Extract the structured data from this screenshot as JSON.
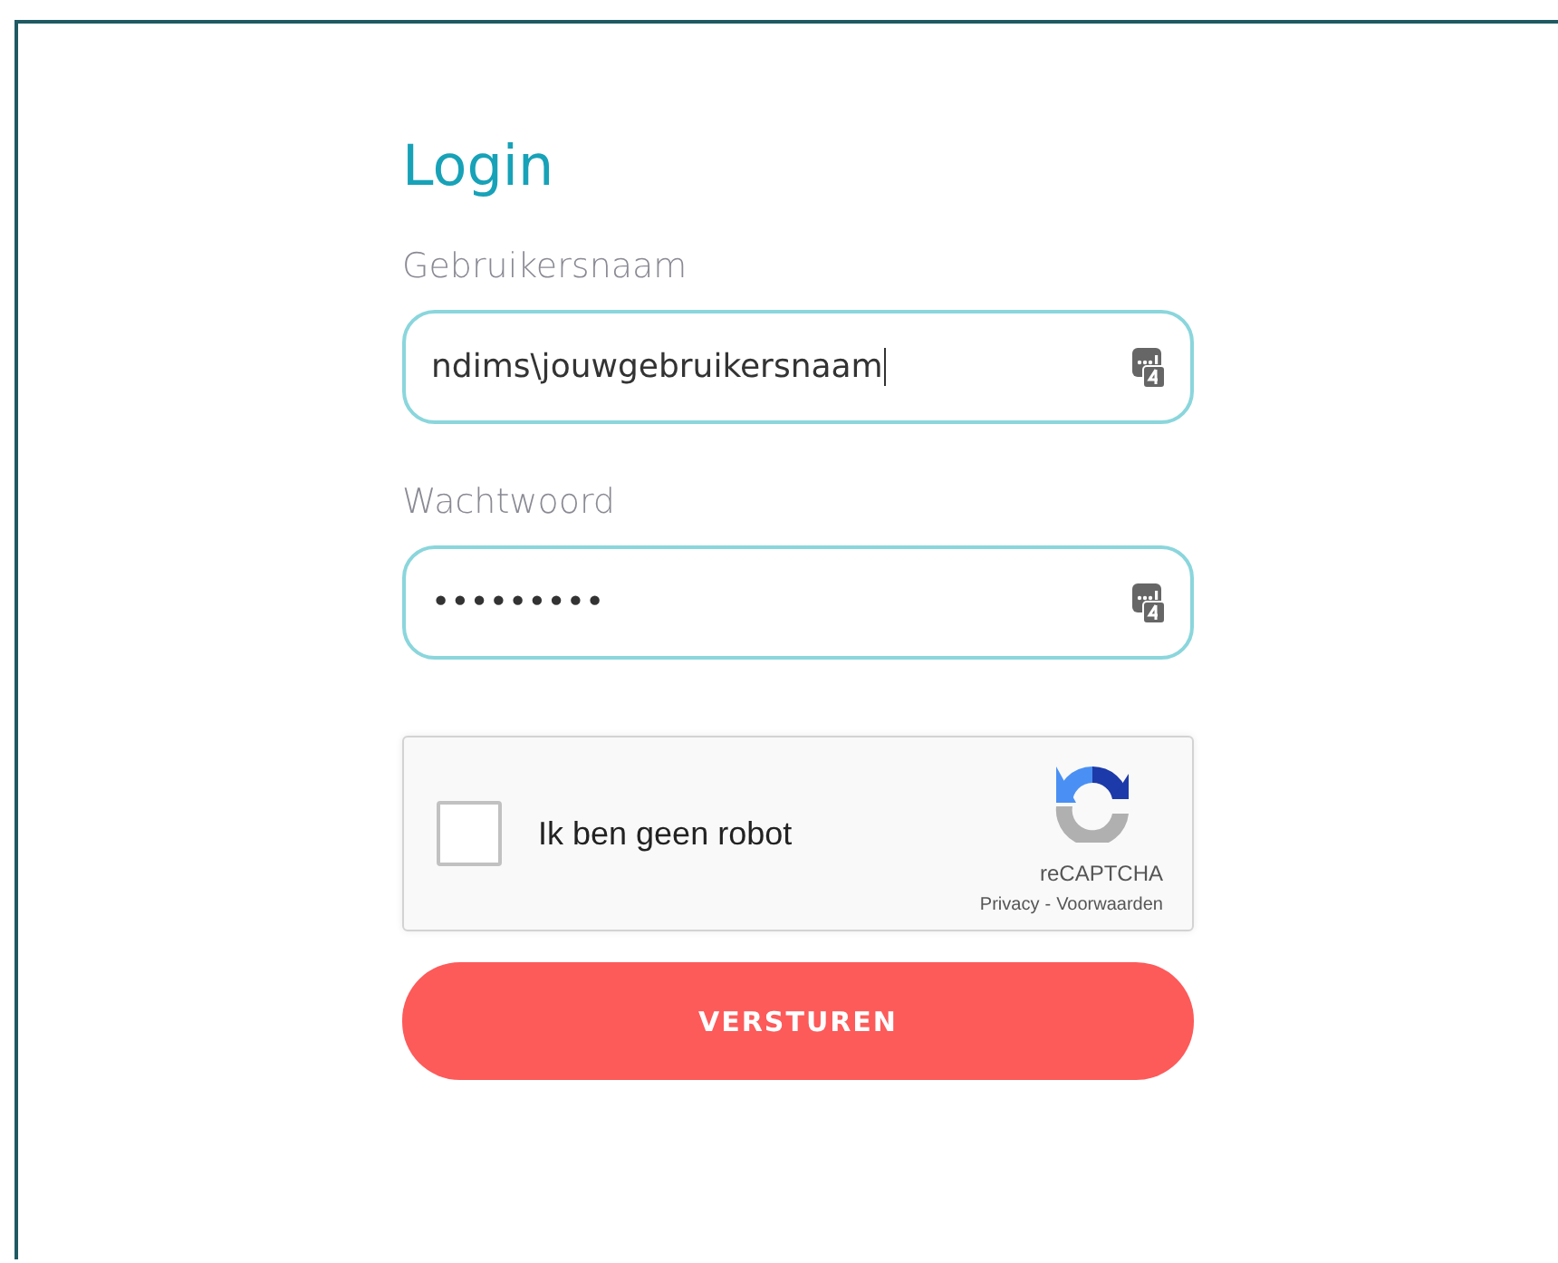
{
  "title": "Login",
  "fields": [
    {
      "label": "Gebruikersnaam",
      "value": "ndims\\jouwgebruikersnaam",
      "focused": true
    },
    {
      "label": "Wachtwoord",
      "value": "•••••••••",
      "focused": false
    }
  ],
  "captcha": {
    "label": "Ik ben geen robot",
    "checked": false,
    "brand": "reCAPTCHA",
    "privacy": "Privacy",
    "separator": "-",
    "terms": "Voorwaarden"
  },
  "submit": "VERSTUREN"
}
